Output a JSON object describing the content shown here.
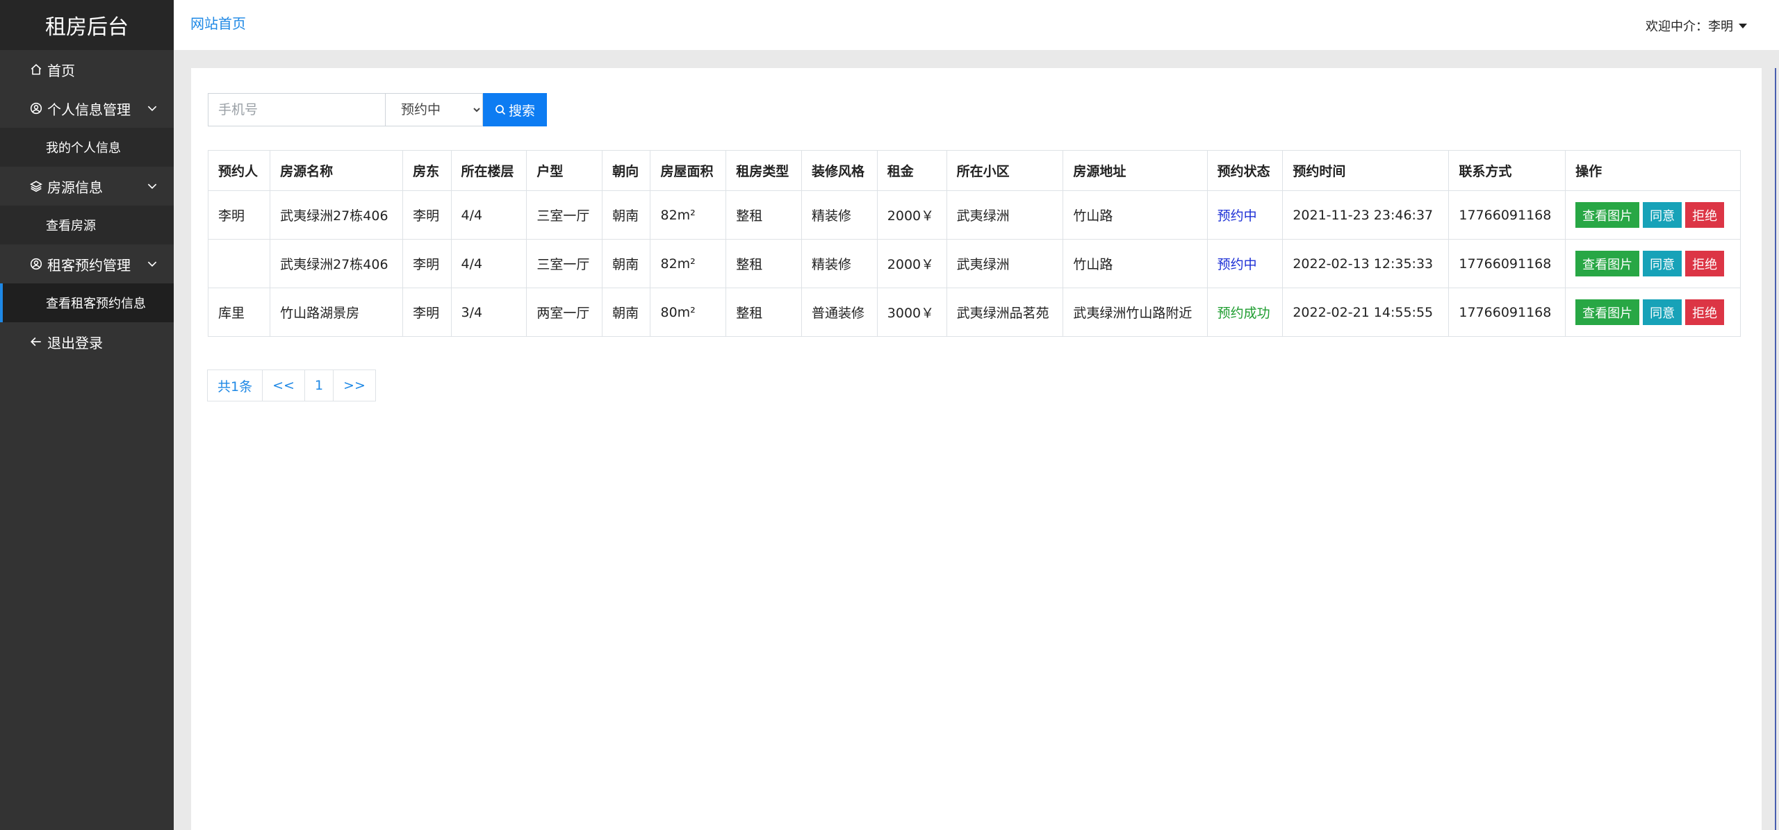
{
  "brand": "租房后台",
  "sidebar": {
    "items": [
      {
        "label": "首页"
      },
      {
        "label": "个人信息管理"
      },
      {
        "label": "我的个人信息"
      },
      {
        "label": "房源信息"
      },
      {
        "label": "查看房源"
      },
      {
        "label": "租客预约管理"
      },
      {
        "label": "查看租客预约信息"
      },
      {
        "label": "退出登录"
      }
    ]
  },
  "topbar": {
    "home_link": "网站首页",
    "welcome": "欢迎中介：李明"
  },
  "search": {
    "phone_placeholder": "手机号",
    "status_selected": "预约中",
    "search_label": "搜索"
  },
  "table": {
    "headers": [
      "预约人",
      "房源名称",
      "房东",
      "所在楼层",
      "户型",
      "朝向",
      "房屋面积",
      "租房类型",
      "装修风格",
      "租金",
      "所在小区",
      "房源地址",
      "预约状态",
      "预约时间",
      "联系方式",
      "操作"
    ],
    "rows": [
      {
        "tenant": "李明",
        "name": "武夷绿洲27栋406",
        "landlord": "李明",
        "floor": "4/4",
        "layout": "三室一厅",
        "orientation": "朝南",
        "area": "82m²",
        "rent_type": "整租",
        "decor": "精装修",
        "rent": "2000￥",
        "community": "武夷绿洲",
        "address": "竹山路",
        "status": "预约中",
        "time": "2021-11-23 23:46:37",
        "phone": "17766091168"
      },
      {
        "tenant": "",
        "name": "武夷绿洲27栋406",
        "landlord": "李明",
        "floor": "4/4",
        "layout": "三室一厅",
        "orientation": "朝南",
        "area": "82m²",
        "rent_type": "整租",
        "decor": "精装修",
        "rent": "2000￥",
        "community": "武夷绿洲",
        "address": "竹山路",
        "status": "预约中",
        "time": "2022-02-13 12:35:33",
        "phone": "17766091168"
      },
      {
        "tenant": "库里",
        "name": "竹山路湖景房",
        "landlord": "李明",
        "floor": "3/4",
        "layout": "两室一厅",
        "orientation": "朝南",
        "area": "80m²",
        "rent_type": "整租",
        "decor": "普通装修",
        "rent": "3000￥",
        "community": "武夷绿洲品茗苑",
        "address": "武夷绿洲竹山路附近",
        "status": "预约成功",
        "time": "2022-02-21 14:55:55",
        "phone": "17766091168"
      }
    ],
    "actions": {
      "view": "查看图片",
      "agree": "同意",
      "reject": "拒绝"
    }
  },
  "pagination": {
    "total": "共1条",
    "prev": "<<",
    "page": "1",
    "next": ">>"
  },
  "colors": {
    "sidebar_bg": "#333333",
    "brand_bg": "#262626",
    "primary": "#0d7cf2",
    "link": "#1e88e5",
    "pending": "#1c2fd6",
    "success": "#1f9d30"
  }
}
